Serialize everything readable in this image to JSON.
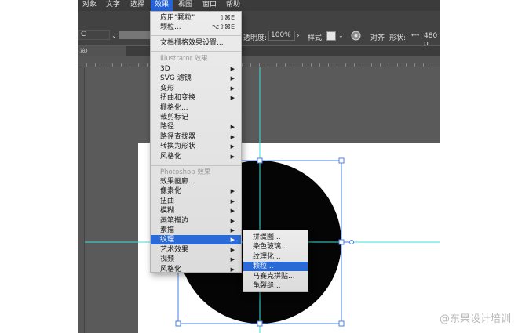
{
  "menubar": {
    "items": [
      "对象",
      "文字",
      "选择",
      "效果",
      "视图",
      "窗口",
      "帮助"
    ],
    "active_index": 3
  },
  "controlbar": {
    "left_fragment": "C",
    "opacity_label": "透明度:",
    "opacity_value": "100%",
    "style_label": "样式:",
    "align_label": "对齐",
    "shape_label": "形状:",
    "width_value": "480 p"
  },
  "doctab": {
    "label": "览)"
  },
  "effect_menu": {
    "apply_last": {
      "label": "应用\"颗粒\"",
      "shortcut": "⇧⌘E"
    },
    "last_effect": {
      "label": "颗粒...",
      "shortcut": "⌥⇧⌘E"
    },
    "raster_settings": "文档栅格效果设置...",
    "illustrator_header": "Illustrator 效果",
    "illustrator_items": [
      {
        "label": "3D",
        "submenu": true
      },
      {
        "label": "SVG 滤镜",
        "submenu": true
      },
      {
        "label": "变形",
        "submenu": true
      },
      {
        "label": "扭曲和变换",
        "submenu": true
      },
      {
        "label": "栅格化...",
        "submenu": false
      },
      {
        "label": "裁剪标记",
        "submenu": false
      },
      {
        "label": "路径",
        "submenu": true
      },
      {
        "label": "路径查找器",
        "submenu": true
      },
      {
        "label": "转换为形状",
        "submenu": true
      },
      {
        "label": "风格化",
        "submenu": true
      }
    ],
    "photoshop_header": "Photoshop 效果",
    "photoshop_items": [
      {
        "label": "效果画廊...",
        "submenu": false
      },
      {
        "label": "像素化",
        "submenu": true
      },
      {
        "label": "扭曲",
        "submenu": true
      },
      {
        "label": "模糊",
        "submenu": true
      },
      {
        "label": "画笔描边",
        "submenu": true
      },
      {
        "label": "素描",
        "submenu": true
      },
      {
        "label": "纹理",
        "submenu": true,
        "highlighted": true
      },
      {
        "label": "艺术效果",
        "submenu": true
      },
      {
        "label": "视频",
        "submenu": true
      },
      {
        "label": "风格化",
        "submenu": true
      }
    ],
    "arrow_glyph": "▶"
  },
  "texture_submenu": {
    "items": [
      {
        "label": "拼缀图...",
        "highlighted": false
      },
      {
        "label": "染色玻璃...",
        "highlighted": false
      },
      {
        "label": "纹理化...",
        "highlighted": false
      },
      {
        "label": "颗粒...",
        "highlighted": true
      },
      {
        "label": "马赛克拼贴...",
        "highlighted": false
      },
      {
        "label": "龟裂缝...",
        "highlighted": false
      }
    ]
  },
  "watermark": "@东果设计培训",
  "colors": {
    "highlight": "#2a6ad6",
    "guide": "#38e0e0",
    "selection": "#4a7ff0",
    "circle": "#050505"
  },
  "icons": {
    "fill_swatch": "swatch",
    "recolor": "recolor-icon",
    "width_tool": "width-icon"
  }
}
